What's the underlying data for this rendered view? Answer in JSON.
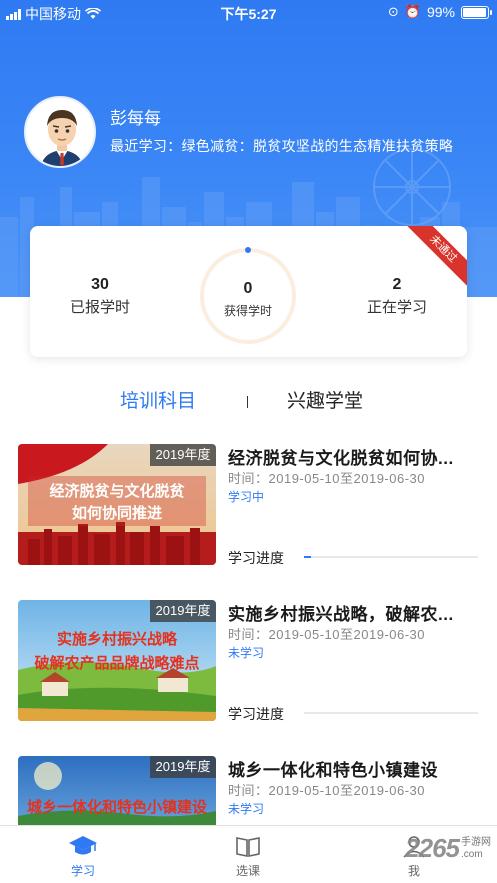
{
  "status_bar": {
    "carrier": "中国移动",
    "time": "下午5:27",
    "battery": "99%"
  },
  "profile": {
    "name": "彭每每",
    "recent": "最近学习：绿色减贫：脱贫攻坚战的生态精准扶贫策略"
  },
  "stats": {
    "reported": {
      "value": "30",
      "label": "已报学时"
    },
    "earned": {
      "value": "0",
      "label": "获得学时"
    },
    "learning": {
      "value": "2",
      "label": "正在学习"
    },
    "badge": "未通过"
  },
  "tabs": {
    "active": "培训科目",
    "other": "兴趣学堂"
  },
  "courses": [
    {
      "year": "2019年度",
      "thumb_line1": "经济脱贫与文化脱贫",
      "thumb_line2": "如何协同推进",
      "title": "经济脱贫与文化脱贫如何协...",
      "time": "时间：2019-05-10至2019-06-30",
      "status": "学习中",
      "progress_label": "学习进度",
      "progress": 0.04
    },
    {
      "year": "2019年度",
      "thumb_line1": "实施乡村振兴战略",
      "thumb_line2": "破解农产品品牌战略难点",
      "title": "实施乡村振兴战略，破解农...",
      "time": "时间：2019-05-10至2019-06-30",
      "status": "未学习",
      "progress_label": "学习进度",
      "progress": 0
    },
    {
      "year": "2019年度",
      "thumb_line1": "城乡一体化和特色小镇建设",
      "title": "城乡一体化和特色小镇建设",
      "time": "时间：2019-05-10至2019-06-30",
      "status": "未学习"
    }
  ],
  "nav": {
    "study": "学习",
    "courses": "选课",
    "me": "我"
  },
  "watermark": {
    "number": "2265",
    "label1": "手游网",
    "label2": ".com"
  },
  "colors": {
    "primary": "#2f7af2",
    "badge_red": "#d9342b"
  },
  "icons": {
    "study": "graduation-cap-icon",
    "courses": "book-icon",
    "me": "person-icon"
  }
}
